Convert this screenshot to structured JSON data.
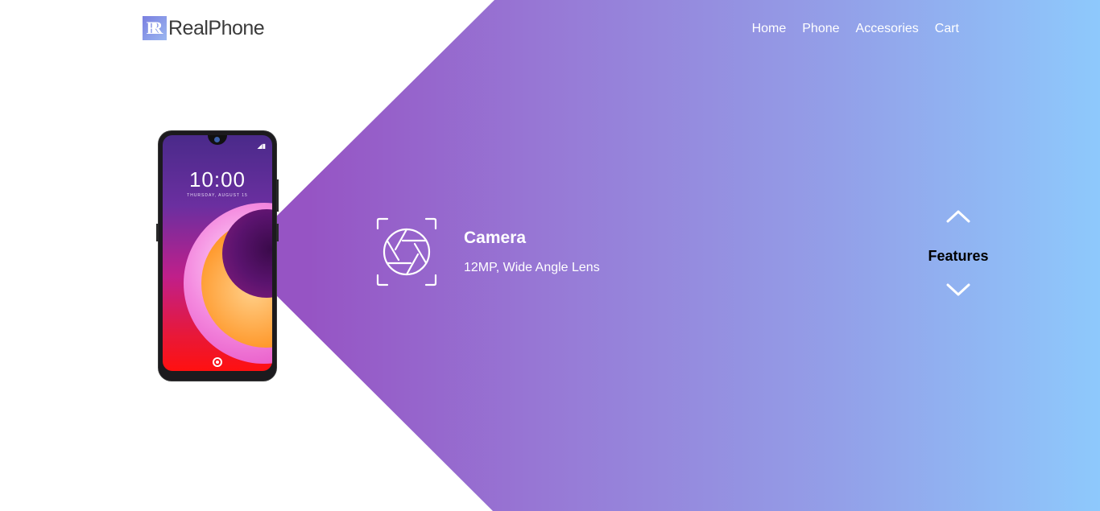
{
  "header": {
    "logo_mark": "R",
    "logo_text": "RealPhone",
    "nav": [
      "Home",
      "Phone",
      "Accesories",
      "Cart"
    ]
  },
  "phone": {
    "time": "10:00",
    "date": "THURSDAY, AUGUST 15"
  },
  "feature": {
    "icon": "camera-aperture-icon",
    "title": "Camera",
    "description": "12MP, Wide Angle Lens"
  },
  "features_nav": {
    "label": "Features",
    "up_icon": "chevron-up-icon",
    "down_icon": "chevron-down-icon"
  },
  "colors": {
    "gradient_start": "#9654c4",
    "gradient_end": "#8ec9fc",
    "text_light": "#ffffff",
    "logo_text": "#3b3b3b"
  }
}
